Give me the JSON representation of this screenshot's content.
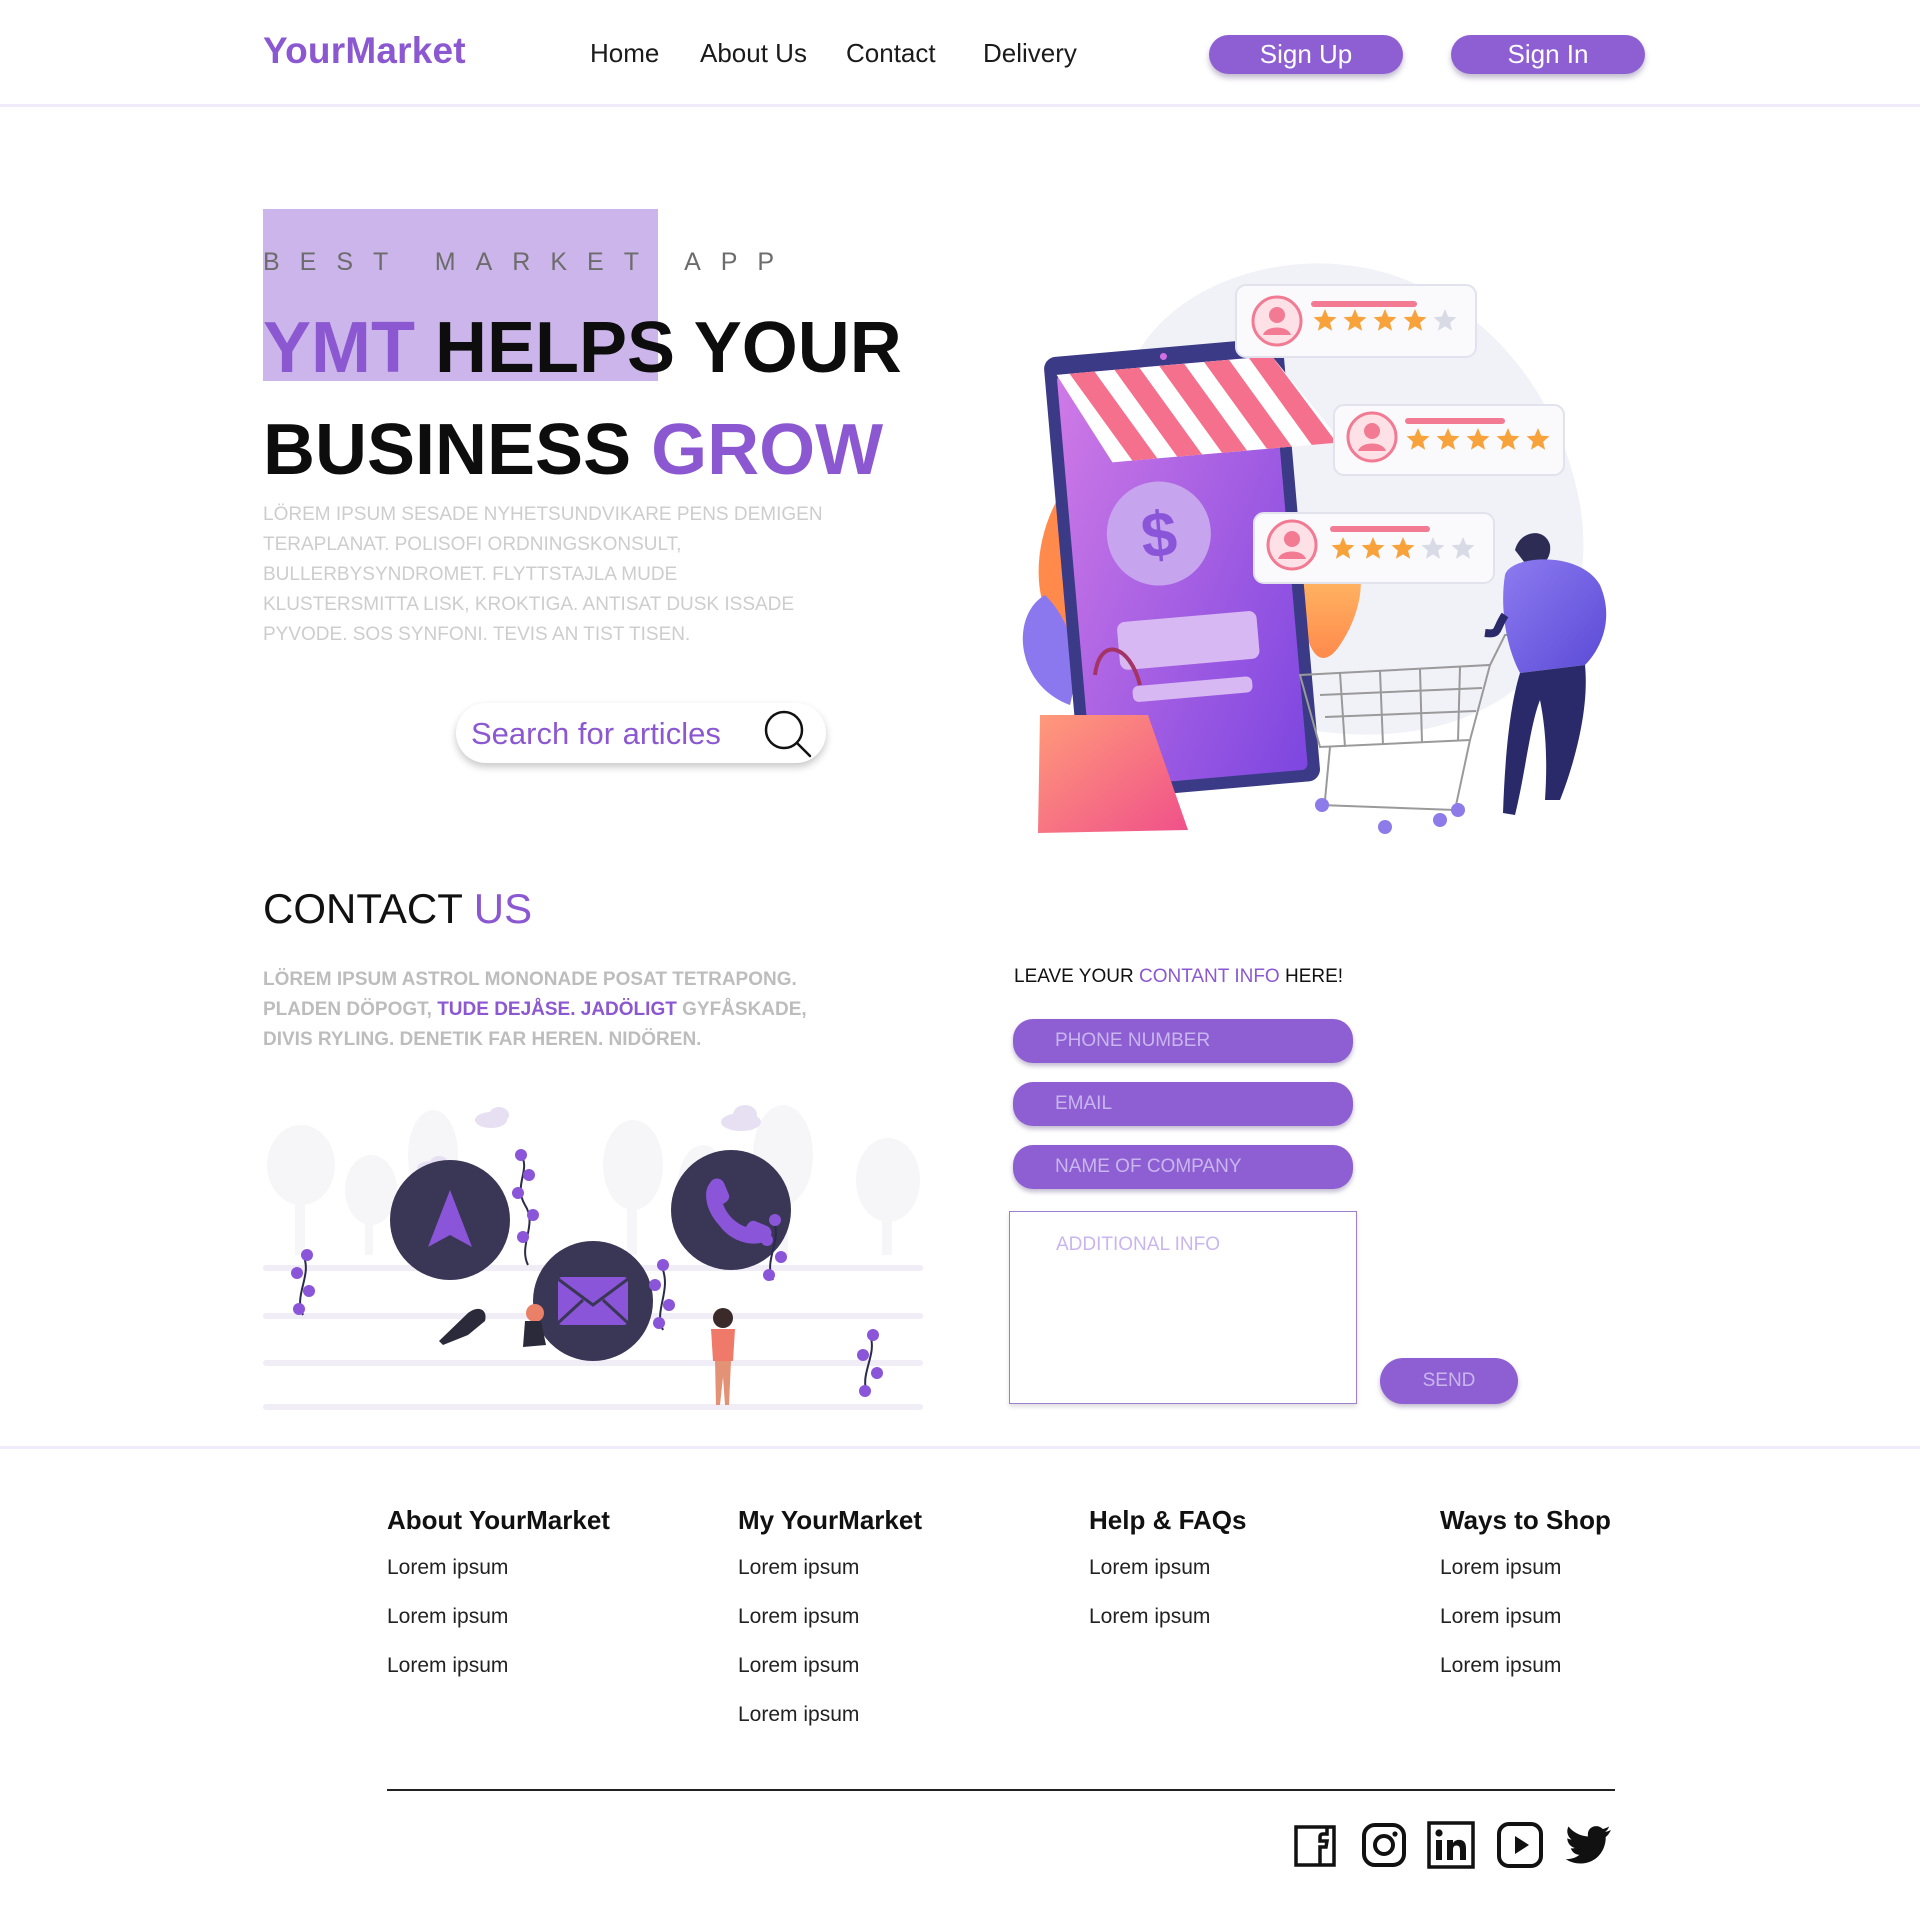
{
  "brand": {
    "name": "YourMarket",
    "accent_color": "#8b58d1",
    "button_color": "#8e5fd3"
  },
  "nav": {
    "items": [
      "Home",
      "About Us",
      "Contact",
      "Delivery"
    ]
  },
  "auth": {
    "signup_label": "Sign Up",
    "signin_label": "Sign In"
  },
  "hero": {
    "eyebrow": "BEST MARKET APP",
    "line1_accent": "YMT",
    "line1_rest": " HELPS YOUR",
    "line2_rest": "BUSINESS ",
    "line2_accent": "GROW",
    "body": "LÖREM IPSUM SESADE NYHETSUNDVIKARE PENS DEMIGEN TERAPLANAT. POLISOFI ORDNINGSKONSULT, BULLERBYSYNDROMET. FLYTTSTAJLA MUDE KLUSTERSMITTA LISK, KROKTIGA. ANTISAT DUSK ISSADE PYVODE. SOS SYNFONI. TEVIS AN TIST TISEN.",
    "search_placeholder": "Search for articles"
  },
  "contact": {
    "title_main": "CONTACT ",
    "title_accent": "US",
    "body_part1": "LÖREM IPSUM ASTROL MONONADE POSAT TETRAPONG. PLADEN DÖPOGT, ",
    "body_accent": "TUDE DEJÅSE. JADÖLIGT",
    "body_part2": " GYFÅSKADE, DIVIS RYLING. DENETIK FAR HEREN. NIDÖREN.",
    "form_heading_part1": "LEAVE YOUR ",
    "form_heading_accent": "CONTANT INFO",
    "form_heading_part2": " HERE!",
    "fields": {
      "phone": "PHONE NUMBER",
      "email": "EMAIL",
      "company": "NAME OF COMPANY",
      "additional": "ADDITIONAL INFO"
    },
    "send_label": "SEND"
  },
  "illustration": {
    "product_ratings": [
      4,
      5,
      3
    ]
  },
  "footer": {
    "columns": [
      {
        "title": "About YourMarket",
        "links": [
          "Lorem ipsum",
          "Lorem ipsum",
          "Lorem ipsum"
        ]
      },
      {
        "title": "My YourMarket",
        "links": [
          "Lorem ipsum",
          "Lorem ipsum",
          "Lorem ipsum",
          "Lorem ipsum"
        ]
      },
      {
        "title": "Help & FAQs",
        "links": [
          "Lorem ipsum",
          "Lorem ipsum"
        ]
      },
      {
        "title": "Ways to Shop",
        "links": [
          "Lorem ipsum",
          "Lorem ipsum",
          "Lorem ipsum"
        ]
      }
    ],
    "social_icons": [
      "facebook-icon",
      "instagram-icon",
      "linkedin-icon",
      "youtube-icon",
      "twitter-icon"
    ]
  }
}
